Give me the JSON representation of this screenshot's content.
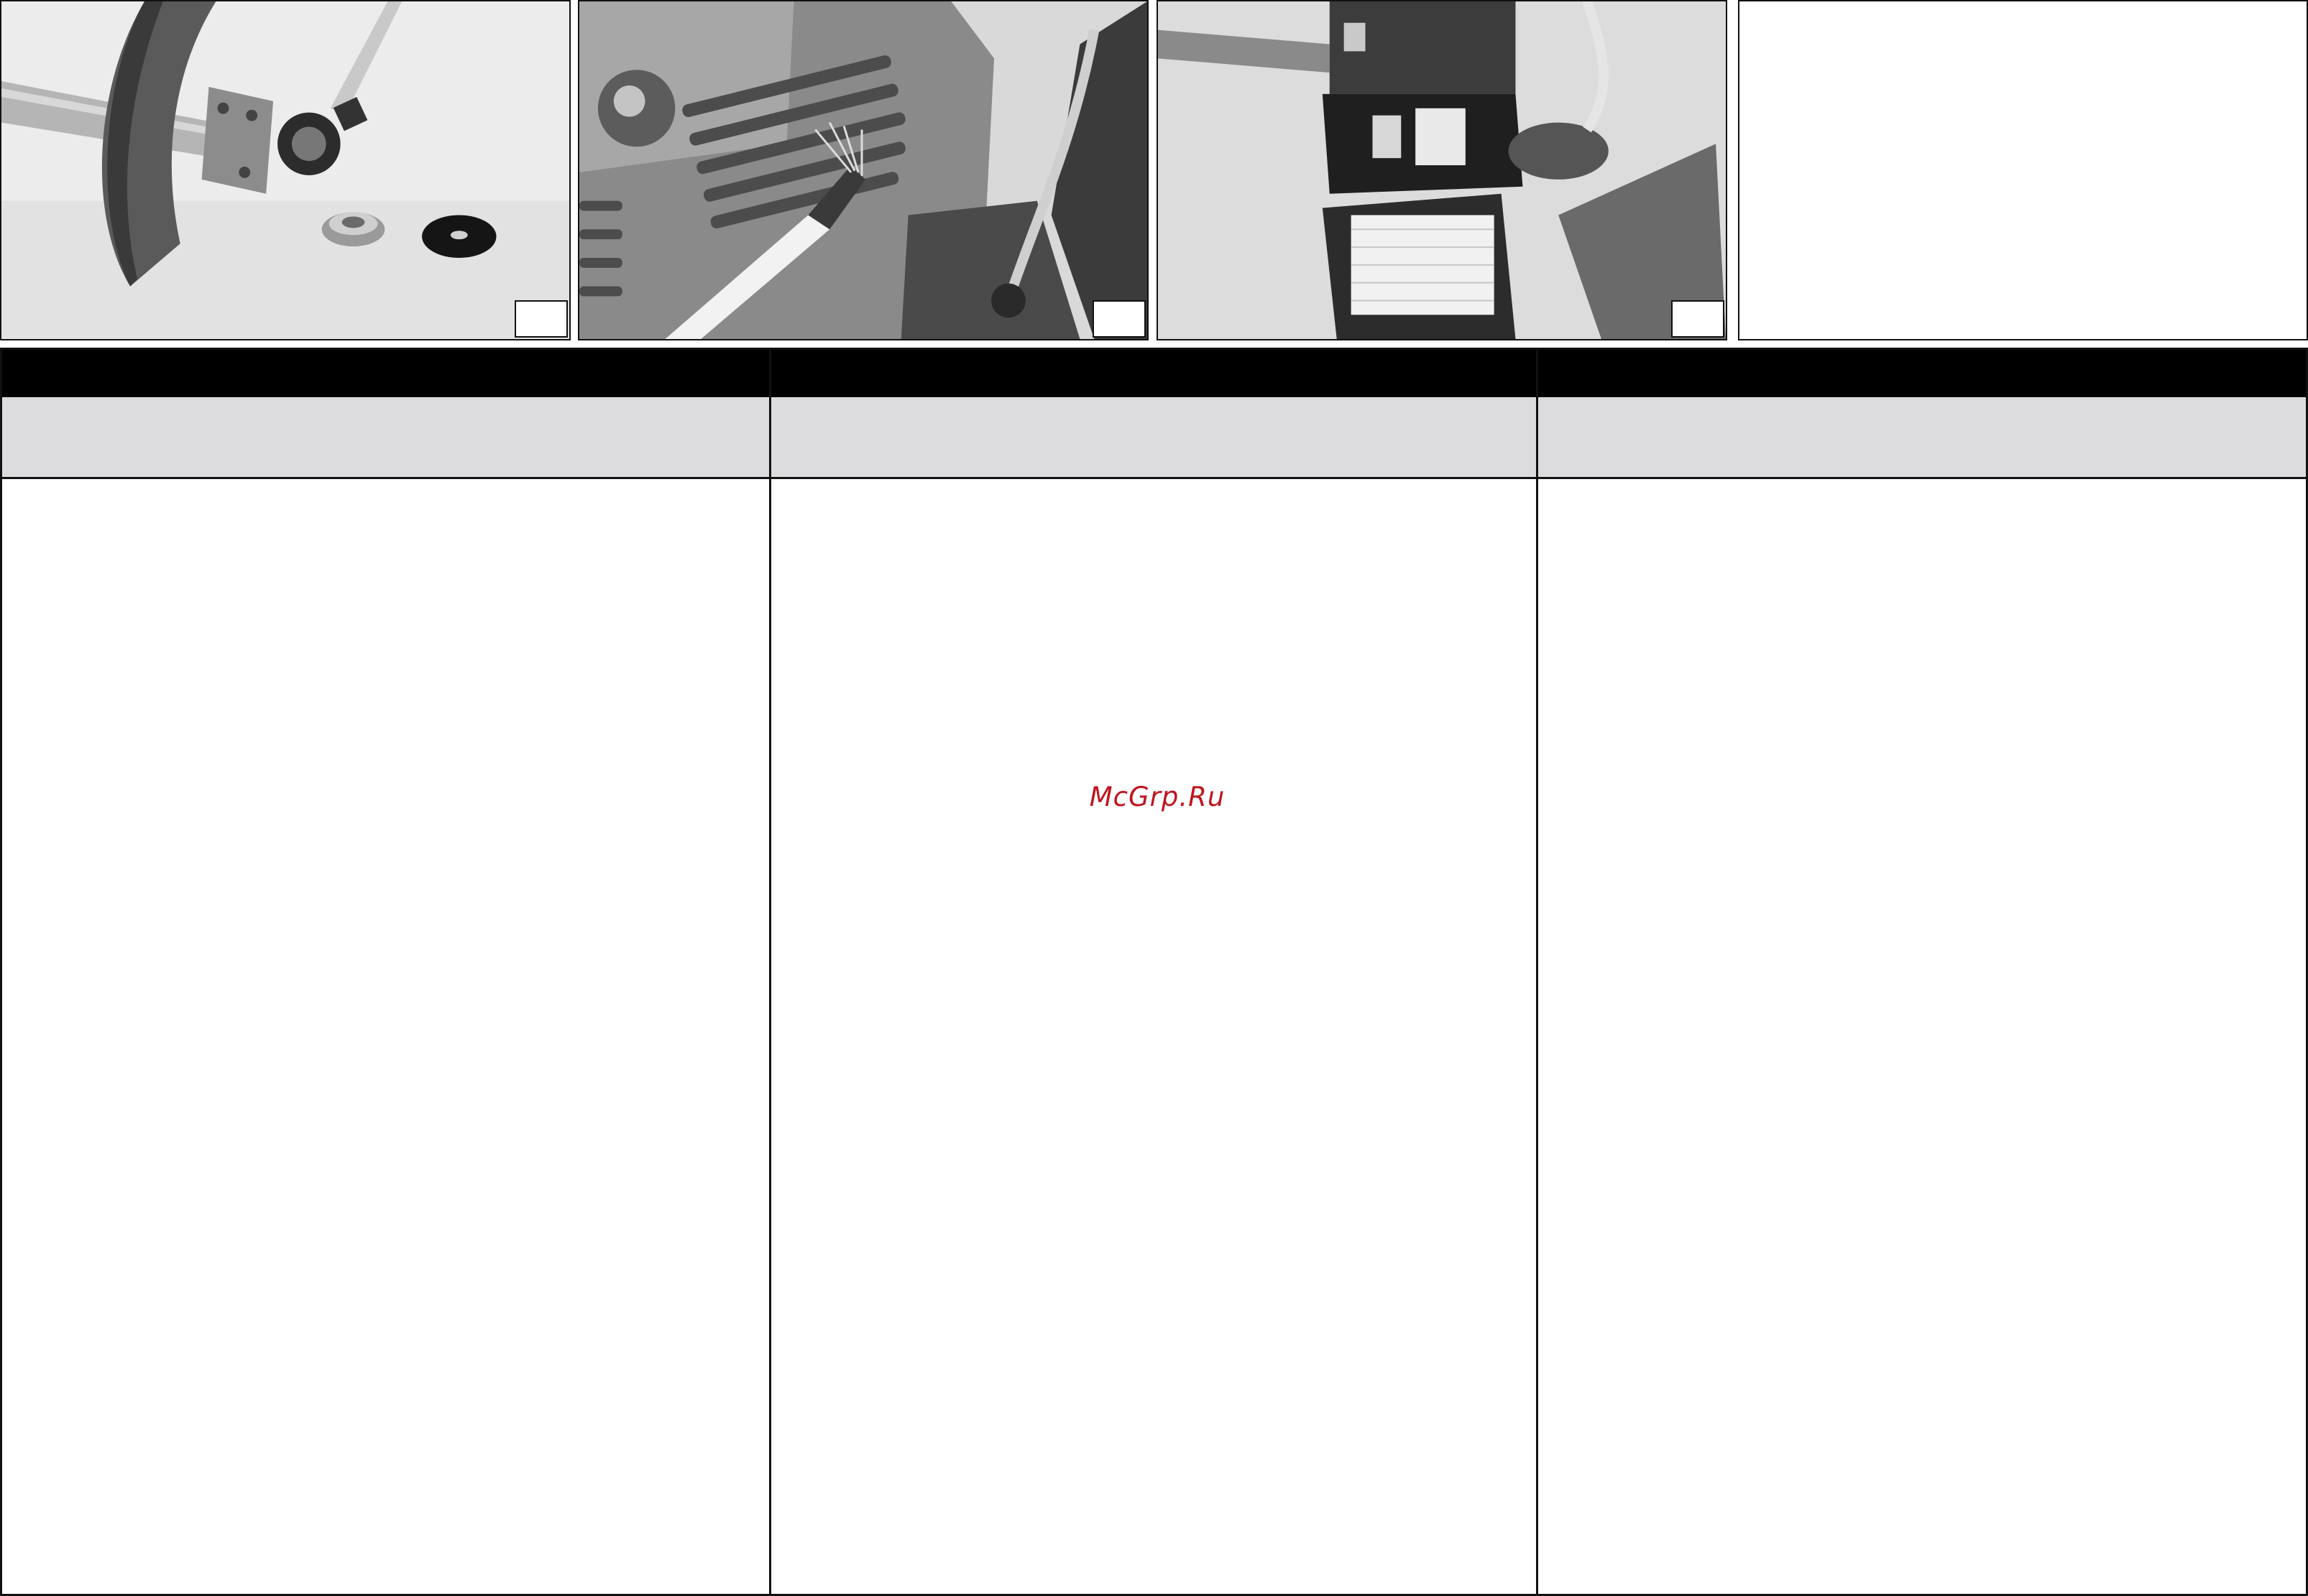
{
  "photos": [
    {
      "name": "trimmer-head-flange-photo",
      "number": ""
    },
    {
      "name": "cylinder-fins-brush-photo",
      "number": ""
    },
    {
      "name": "air-filter-cover-photo",
      "number": ""
    },
    {
      "name": "empty-photo-frame",
      "number": ""
    }
  ],
  "columns": [
    {
      "heading": "",
      "subheading": "",
      "body": ""
    },
    {
      "heading": "",
      "subheading": "",
      "body": ""
    },
    {
      "heading": "",
      "subheading": "",
      "body": ""
    }
  ],
  "watermark": "McGrp.Ru"
}
